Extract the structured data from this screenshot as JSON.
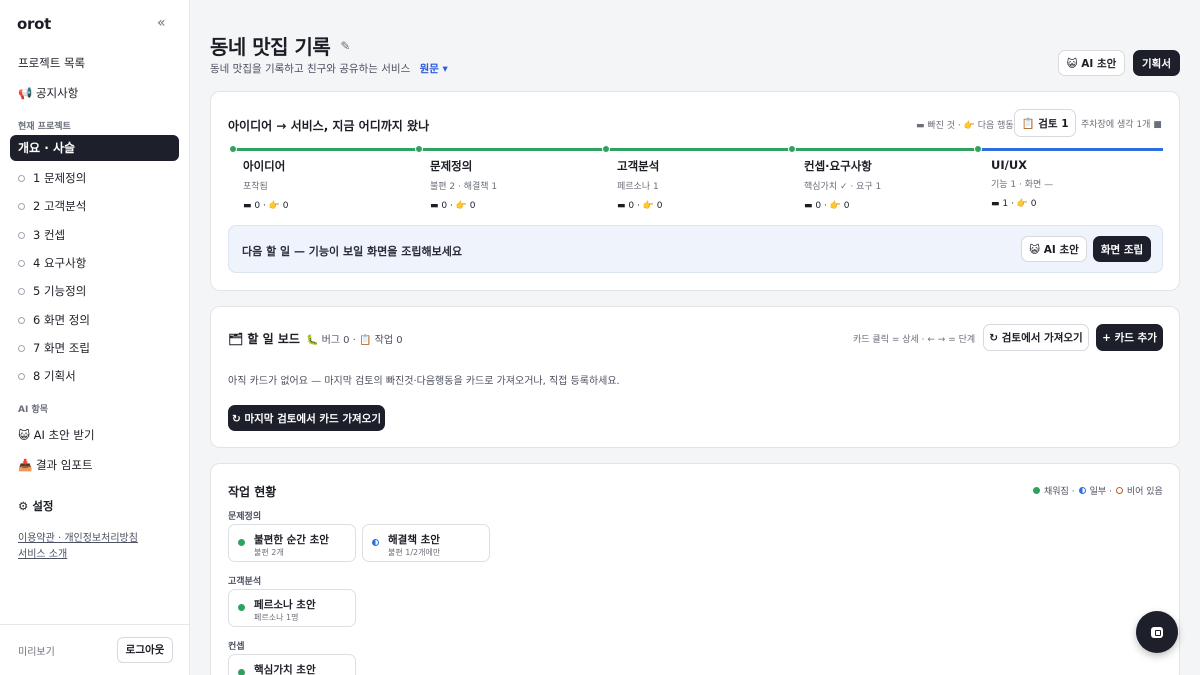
{
  "sidebar": {
    "logo": "orot",
    "collapse": "«",
    "projects_link": "프로젝트 목록",
    "notice_link": "📢 공지사항",
    "current_section": "현재 프로젝트",
    "active_item": "개요 · 사슬",
    "steps": [
      "1 문제정의",
      "2 고객분석",
      "3 컨셉",
      "4 요구사항",
      "5 기능정의",
      "6 화면 정의",
      "7 화면 조립",
      "8 기획서"
    ],
    "ai_section": "AI 항목",
    "ai_draft": "😺 AI 초안 받기",
    "import": "📥 결과 임포트",
    "settings": "⚙ 설정",
    "terms": "이용약관 · 개인정보처리방침",
    "about": "서비스 소개",
    "preview": "미리보기",
    "logout": "로그아웃"
  },
  "header": {
    "title": "동네 맛집 기록",
    "pencil": "✎",
    "subtitle": "동네 맛집을 기록하고 친구와 공유하는 서비스",
    "original": "원문 ▾",
    "ai_btn": "😺 AI 초안",
    "spec_btn": "기획서"
  },
  "progress": {
    "title": "아이디어 → 서비스, 지금 어디까지 왔나",
    "legend": "▬ 빠진 것 · 👉 다음 행동",
    "review_btn": "📋 검토 1",
    "parking": "주차장에 생각 1개 ■",
    "phases": [
      {
        "name": "아이디어",
        "sub": "포착됨",
        "count": "▬ 0 · 👉 0"
      },
      {
        "name": "문제정의",
        "sub": "불편 2 · 해결책 1",
        "count": "▬ 0 · 👉 0"
      },
      {
        "name": "고객분석",
        "sub": "페르소나 1",
        "count": "▬ 0 · 👉 0"
      },
      {
        "name": "컨셉·요구사항",
        "sub": "핵심가치 ✓ · 요구 1",
        "count": "▬ 0 · 👉 0"
      },
      {
        "name": "UI/UX",
        "sub": "기능 1 · 화면 —",
        "count": "▬ 1 · 👉 0"
      }
    ],
    "next_text": "다음 할 일 — 기능이 보일 화면을 조립해보세요",
    "next_ai": "😺 AI 초안",
    "next_assemble": "화면 조립"
  },
  "board": {
    "title": "🗂 할 일 보드",
    "bugs": "🐛 버그 0 · 📋 작업 0",
    "hint": "카드 클릭 = 상세 · ← → = 단계",
    "import_btn": "↻ 검토에서 가져오기",
    "add_btn": "+ 카드 추가",
    "empty": "아직 카드가 없어요 — 마지막 검토의 빠진것·다음행동을 카드로 가져오거나, 직접 등록하세요.",
    "import_last_btn": "↻ 마지막 검토에서 카드 가져오기"
  },
  "status": {
    "title": "작업 현황",
    "legend_full": "채워짐 ·",
    "legend_part": "일부 ·",
    "legend_empty": "비어 있음",
    "groups": [
      {
        "name": "문제정의",
        "tiles": [
          {
            "name": "불편한 순간 초안",
            "sub": "불편 2개",
            "state": "full"
          },
          {
            "name": "해결책 초안",
            "sub": "불편 1/2개에만",
            "state": "partial"
          }
        ]
      },
      {
        "name": "고객분석",
        "tiles": [
          {
            "name": "페르소나 초안",
            "sub": "페르소나 1명",
            "state": "full"
          }
        ]
      },
      {
        "name": "컨셉",
        "tiles": [
          {
            "name": "핵심가치 초안",
            "sub": "",
            "state": "full"
          }
        ]
      }
    ]
  },
  "colors": {
    "accent_dark": "#1d1f2b",
    "done_green": "#2fa35d",
    "active_blue": "#2e6fe0"
  }
}
